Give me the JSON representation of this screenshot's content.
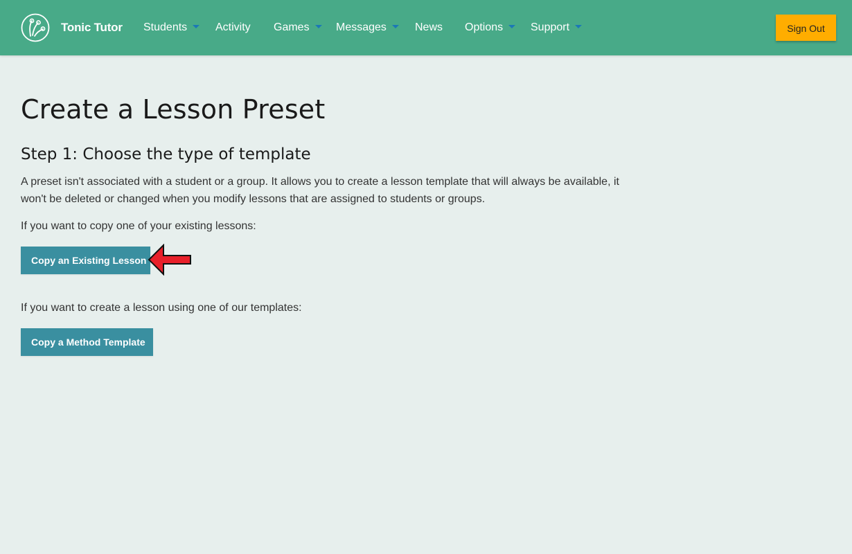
{
  "app": {
    "brand": "Tonic Tutor",
    "logo_icon": "tonic-tutor-logo-icon"
  },
  "nav": {
    "items": [
      {
        "label": "Students",
        "has_dropdown": true
      },
      {
        "label": "Activity",
        "has_dropdown": false
      },
      {
        "label": "Games",
        "has_dropdown": true
      },
      {
        "label": "Messages",
        "has_dropdown": true
      },
      {
        "label": "News",
        "has_dropdown": false
      },
      {
        "label": "Options",
        "has_dropdown": true
      },
      {
        "label": "Support",
        "has_dropdown": true
      }
    ],
    "sign_out_label": "Sign Out"
  },
  "main": {
    "title": "Create a Lesson Preset",
    "step_heading": "Step 1: Choose the type of template",
    "description": "A preset isn't associated with a student or a group. It allows you to create a lesson template that will always be available, it won't be deleted or changed when you modify lessons that are assigned to students or groups.",
    "copy_existing_prompt": "If you want to copy one of your existing lessons:",
    "copy_existing_button": "Copy an Existing Lesson",
    "copy_method_prompt": "If you want to create a lesson using one of our templates:",
    "copy_method_button": "Copy a Method Template",
    "annotation_icon": "red-arrow-left-icon"
  },
  "colors": {
    "navbar": "#48aa88",
    "background": "#e7efed",
    "primary_button": "#3a8fa0",
    "sign_out_button": "#ffad00",
    "dropdown_caret": "#1c78b6",
    "annotation_arrow": "#e8202a"
  }
}
